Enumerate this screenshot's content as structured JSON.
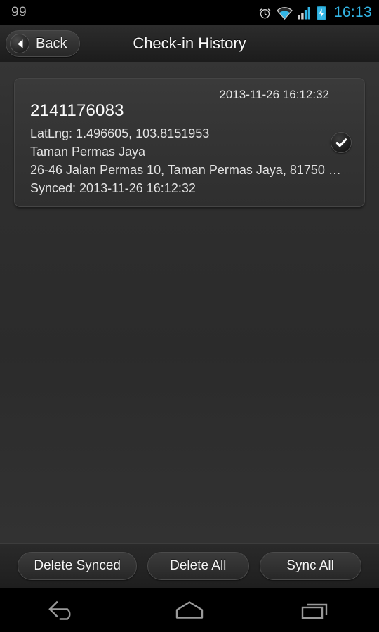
{
  "status_bar": {
    "left_text": "99",
    "clock": "16:13",
    "clock_color": "#33b5e5",
    "icons": [
      "alarm-clock-icon",
      "wifi-icon",
      "cellular-signal-icon",
      "battery-charging-icon"
    ]
  },
  "action_bar": {
    "back_label": "Back",
    "back_icon": "chevron-left-icon",
    "title": "Check-in History"
  },
  "checkins": [
    {
      "id": "2141176083",
      "timestamp": "2013-11-26 16:12:32",
      "latlng": "LatLng: 1.496605, 103.8151953",
      "place": "Taman Permas Jaya",
      "address": "26-46 Jalan Permas 10, Taman Permas Jaya, 81750 …",
      "synced": "Synced: 2013-11-26 16:12:32",
      "sync_badge_icon": "check-icon"
    }
  ],
  "button_bar": {
    "delete_synced_label": "Delete Synced",
    "delete_all_label": "Delete All",
    "sync_all_label": "Sync All"
  },
  "nav_bar": {
    "back_icon": "nav-back-icon",
    "home_icon": "nav-home-icon",
    "recents_icon": "nav-recents-icon"
  },
  "colors": {
    "accent": "#33b5e5",
    "background": "#2f2f2f",
    "card": "#343434",
    "text": "#f2f2f2"
  }
}
